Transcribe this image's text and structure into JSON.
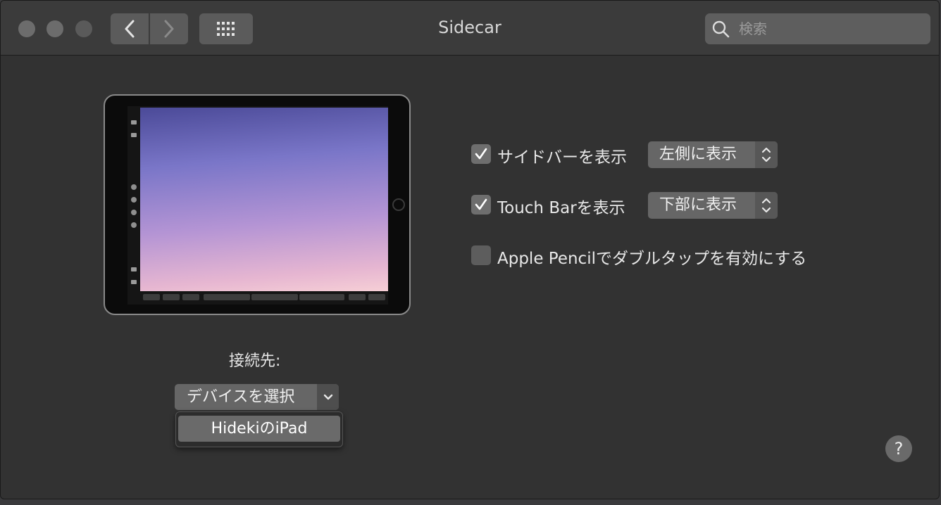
{
  "window": {
    "title": "Sidecar"
  },
  "search": {
    "placeholder": "検索"
  },
  "options": {
    "sidebar_label": "サイドバーを表示",
    "sidebar_checked": true,
    "sidebar_position": "左側に表示",
    "touchbar_label": "Touch Barを表示",
    "touchbar_checked": true,
    "touchbar_position": "下部に表示",
    "pencil_label": "Apple Pencilでダブルタップを有効にする",
    "pencil_checked": false
  },
  "connect": {
    "label": "接続先:",
    "select_label": "デバイスを選択",
    "menu_items": [
      "HidekiのiPad"
    ]
  },
  "help": {
    "label": "?"
  },
  "colors": {
    "window_bg": "#323232",
    "titlebar_bg": "#3b3b3b",
    "control_bg": "#666666",
    "text": "#e6e6e6"
  }
}
